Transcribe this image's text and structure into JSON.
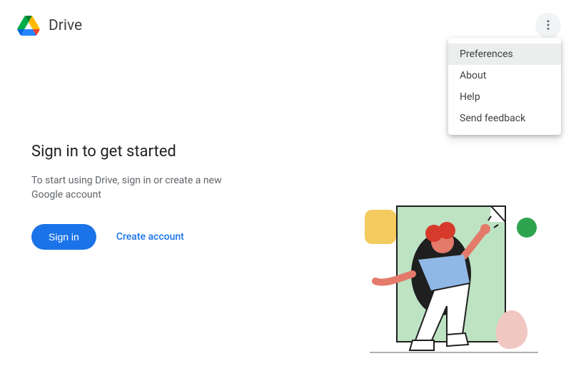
{
  "header": {
    "app_title": "Drive"
  },
  "menu": {
    "items": [
      {
        "label": "Preferences",
        "highlighted": true
      },
      {
        "label": "About",
        "highlighted": false
      },
      {
        "label": "Help",
        "highlighted": false
      },
      {
        "label": "Send feedback",
        "highlighted": false
      }
    ]
  },
  "main": {
    "headline": "Sign in to get started",
    "subtext": "To start using Drive, sign in or create a new Google account",
    "sign_in_label": "Sign in",
    "create_account_label": "Create account"
  },
  "colors": {
    "primary": "#1a73e8",
    "text_primary": "#202124",
    "text_secondary": "#5f6368"
  }
}
